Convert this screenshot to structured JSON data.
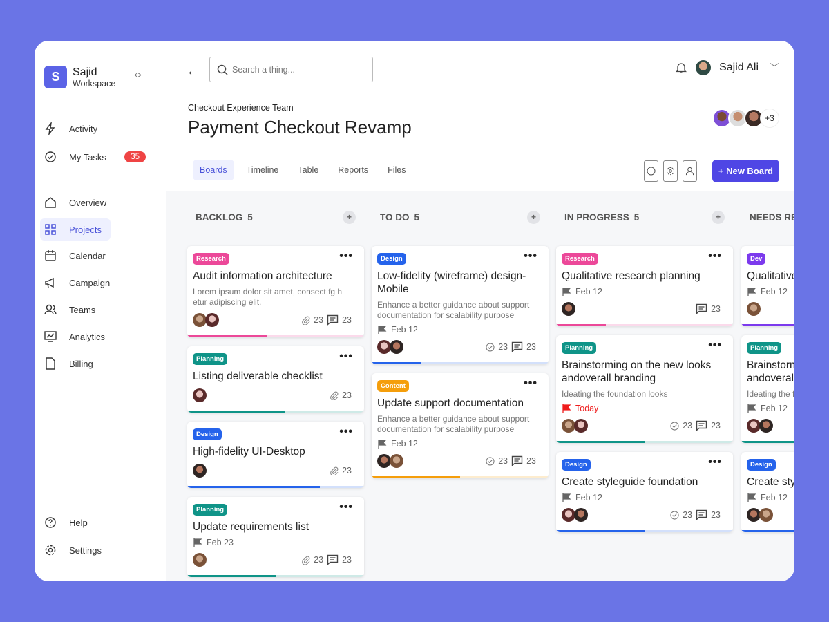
{
  "workspace": {
    "name": "Sajid",
    "sub": "Workspace",
    "initial": "S"
  },
  "nav": [
    {
      "label": "Activity",
      "icon": "activity-icon"
    },
    {
      "label": "My Tasks",
      "icon": "check-circle-icon",
      "badge": "35"
    },
    {
      "label": "Overview",
      "icon": "home-icon"
    },
    {
      "label": "Projects",
      "icon": "grid-icon",
      "active": true
    },
    {
      "label": "Calendar",
      "icon": "calendar-icon"
    },
    {
      "label": "Campaign",
      "icon": "megaphone-icon"
    },
    {
      "label": "Teams",
      "icon": "users-icon"
    },
    {
      "label": "Analytics",
      "icon": "monitor-chart-icon"
    },
    {
      "label": "Billing",
      "icon": "file-icon"
    }
  ],
  "bottom_nav": [
    {
      "label": "Help",
      "icon": "help-icon"
    },
    {
      "label": "Settings",
      "icon": "gear-icon"
    }
  ],
  "header": {
    "search_placeholder": "Search a thing...",
    "user": "Sajid Ali",
    "team": "Checkout Experience Team",
    "title": "Payment Checkout Revamp",
    "extra_members": "+3"
  },
  "tabs": [
    "Boards",
    "Timeline",
    "Table",
    "Reports",
    "Files"
  ],
  "new_board": "+ New Board",
  "colors": {
    "accent": "#4f46e5",
    "Research": "#ec4899",
    "Planning": "#0f9488",
    "Design": "#2563eb",
    "Content": "#f59e0b",
    "Dev": "#7c3aed"
  },
  "columns": [
    {
      "title": "BACKLOG",
      "count": "5",
      "cards": [
        {
          "tag": "Research",
          "title": "Audit information architecture",
          "desc": "Lorem ipsum dolor sit amet, consect fg h etur adipiscing elit.",
          "avatars": 2,
          "attach": "23",
          "comments": "23",
          "progress": 0.45
        },
        {
          "tag": "Planning",
          "title": "Listing deliverable checklist",
          "avatars": 1,
          "attach": "23",
          "progress": 0.55
        },
        {
          "tag": "Design",
          "title": "High-fidelity UI-Desktop",
          "avatars": 1,
          "attach": "23",
          "progress": 0.75
        },
        {
          "tag": "Planning",
          "title": "Update requirements list",
          "date": "Feb 23",
          "avatars": 1,
          "attach": "23",
          "comments": "23",
          "progress": 0.5
        }
      ]
    },
    {
      "title": "TO DO",
      "count": "5",
      "cards": [
        {
          "tag": "Design",
          "title": "Low-fidelity (wireframe) design-Mobile",
          "desc": "Enhance a better guidance about support documentation for scalability purpose",
          "date": "Feb 12",
          "avatars": 2,
          "checks": "23",
          "comments": "23",
          "progress": 0.28
        },
        {
          "tag": "Content",
          "title": "Update support documentation",
          "desc": "Enhance a better guidance about support documentation for scalability purpose",
          "date": "Feb 12",
          "avatars": 2,
          "checks": "23",
          "comments": "23",
          "progress": 0.5
        }
      ]
    },
    {
      "title": "IN PROGRESS",
      "count": "5",
      "cards": [
        {
          "tag": "Research",
          "title": "Qualitative research planning",
          "date": "Feb 12",
          "avatars": 1,
          "comments": "23",
          "progress": 0.28
        },
        {
          "tag": "Planning",
          "title": "Brainstorming on the new looks andoverall branding",
          "desc": "Ideating the foundation looks",
          "date": "Today",
          "today": true,
          "avatars": 2,
          "checks": "23",
          "comments": "23",
          "progress": 0.5
        },
        {
          "tag": "Design",
          "title": "Create styleguide foundation",
          "date": "Feb 12",
          "avatars": 2,
          "checks": "23",
          "comments": "23",
          "progress": 0.5
        }
      ]
    },
    {
      "title": "NEEDS REVIEW",
      "count": "",
      "cards": [
        {
          "tag": "Dev",
          "title": "Qualitative research planning",
          "date": "Feb 12",
          "avatars": 1,
          "progress": 0.8
        },
        {
          "tag": "Planning",
          "title": "Brainstorming on the new looks andoverall branding",
          "desc": "Ideating the foundation looks",
          "date": "Feb 12",
          "avatars": 2,
          "progress": 0.8
        },
        {
          "tag": "Design",
          "title": "Create styleguide foundation",
          "date": "Feb 12",
          "avatars": 2,
          "progress": 0.8
        }
      ]
    }
  ]
}
